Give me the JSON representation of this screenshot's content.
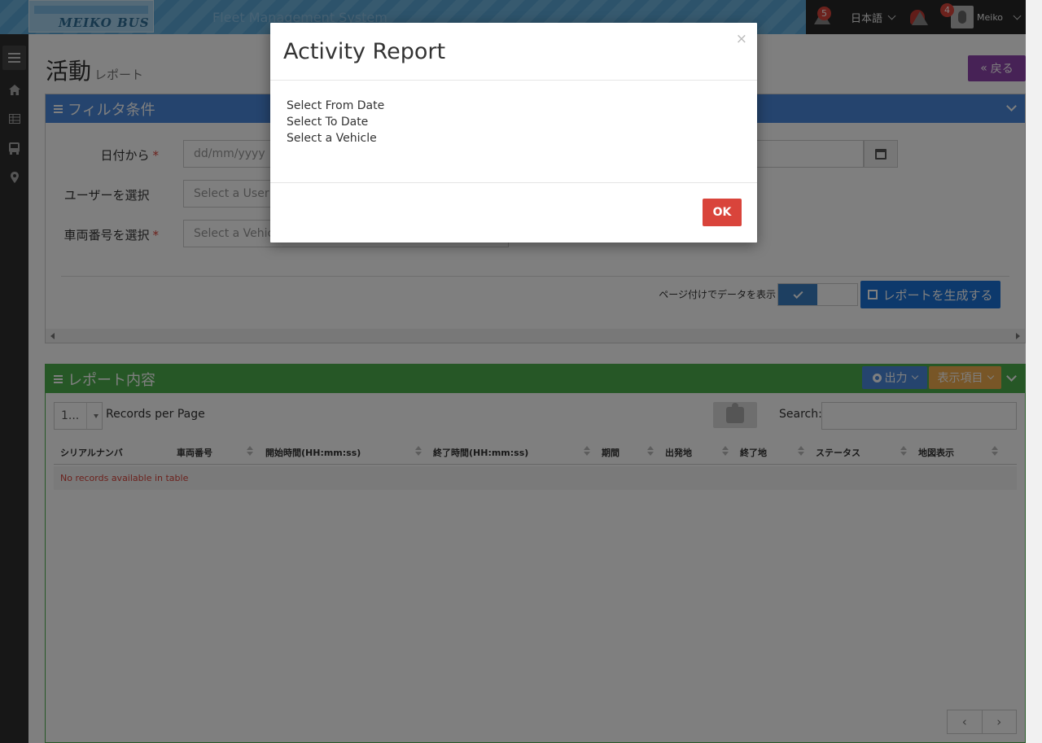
{
  "header": {
    "logo_text": "MEIKO BUS",
    "app_title": "Fleet Management System",
    "alerts_count": "5",
    "language": "日本語",
    "notifications_count": "4",
    "user_name": "Meiko"
  },
  "sidebar": {
    "items": [
      "menu-icon",
      "home-icon",
      "table-icon",
      "bus-icon",
      "map-marker-icon"
    ]
  },
  "page": {
    "title": "活動",
    "subtitle": "レポート",
    "back_label": "戻る"
  },
  "filter": {
    "heading": "フィルタ条件",
    "from_date_label": "日付から",
    "from_date_placeholder": "dd/mm/yyyy",
    "user_label": "ユーザーを選択",
    "user_placeholder": "Select a User",
    "vehicle_label": "車両番号を選択",
    "vehicle_placeholder": "Select a Vehicle",
    "required_mark": "*",
    "paginate_label": "ページ付けでデータを表示",
    "generate_label": "レポートを生成する"
  },
  "report": {
    "heading": "レポート内容",
    "export_label": "出力",
    "columns_label": "表示項目",
    "per_page_value": "1...",
    "per_page_label": "Records per Page",
    "search_label": "Search:",
    "columns": [
      "シリアルナンバ",
      "車両番号",
      "開始時間(HH:mm:ss)",
      "終了時間(HH:mm:ss)",
      "期間",
      "出発地",
      "終了地",
      "ステータス",
      "地図表示"
    ],
    "empty_message": "No records available in table",
    "prev": "‹",
    "next": "›"
  },
  "modal": {
    "title": "Activity Report",
    "close": "×",
    "messages": [
      "Select From Date",
      "Select To Date",
      "Select a Vehicle"
    ],
    "ok_label": "OK"
  },
  "colors": {
    "filter_header": "#4a89dc",
    "report_header": "#4cae4c",
    "back_button": "#8e44ad",
    "generate_button": "#1a73d9",
    "ok_button": "#d9443b",
    "columns_button": "#f0ad4e"
  }
}
